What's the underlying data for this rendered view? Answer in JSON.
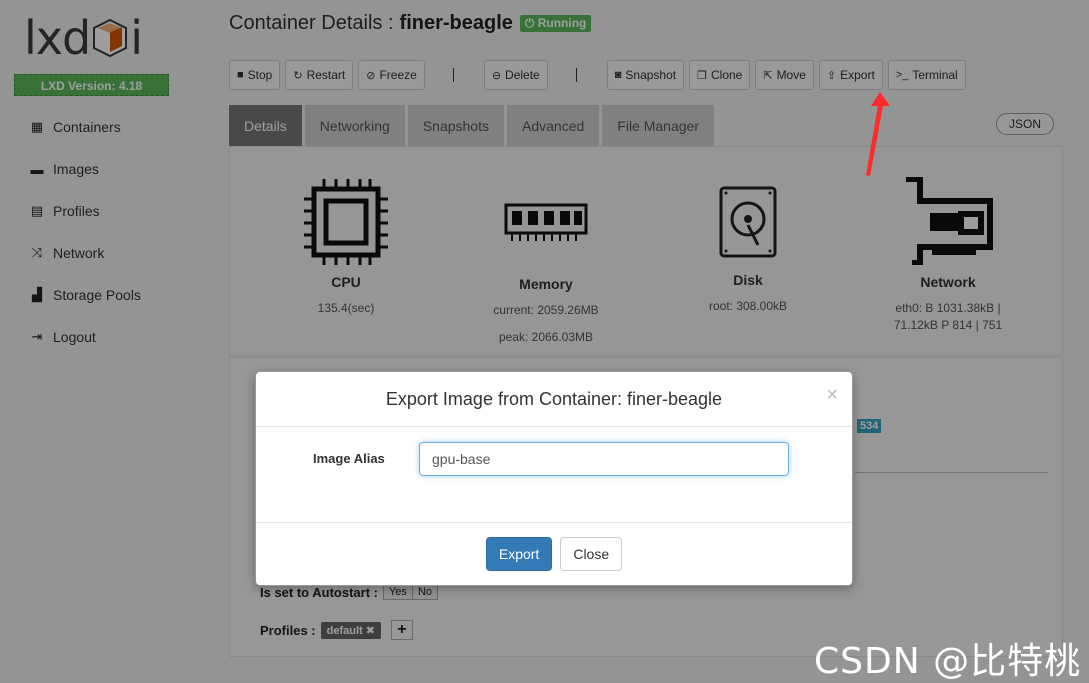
{
  "sidebar": {
    "logo_left": "lxd",
    "logo_right": "i",
    "version": "LXD Version: 4.18",
    "items": [
      {
        "label": "Containers",
        "icon": "grid-icon"
      },
      {
        "label": "Images",
        "icon": "hdd-icon"
      },
      {
        "label": "Profiles",
        "icon": "file-icon"
      },
      {
        "label": "Network",
        "icon": "shuffle-icon"
      },
      {
        "label": "Storage Pools",
        "icon": "tasks-icon"
      },
      {
        "label": "Logout",
        "icon": "logout-icon"
      }
    ]
  },
  "header": {
    "title_prefix": "Container Details :",
    "container_name": "finer-beagle",
    "status": "Running"
  },
  "toolbar": {
    "stop": "Stop",
    "restart": "Restart",
    "freeze": "Freeze",
    "delete": "Delete",
    "snapshot": "Snapshot",
    "clone": "Clone",
    "move": "Move",
    "export": "Export",
    "terminal": "Terminal"
  },
  "tabs": [
    "Details",
    "Networking",
    "Snapshots",
    "Advanced",
    "File Manager"
  ],
  "json_button": "JSON",
  "stats": {
    "cpu": {
      "label": "CPU",
      "value": "135.4(sec)"
    },
    "memory": {
      "label": "Memory",
      "current": "current: 2059.26MB",
      "peak": "peak: 2066.03MB"
    },
    "disk": {
      "label": "Disk",
      "value": "root: 308.00kB"
    },
    "network": {
      "label": "Network",
      "line1": "eth0: B 1031.38kB |",
      "line2": "71.12kB P 814 | 751"
    }
  },
  "details": {
    "badge_value": "534",
    "autostart_label": "Is set to Autostart :",
    "autostart_yes": "Yes",
    "autostart_no": "No",
    "profiles_label": "Profiles :",
    "profile_tag": "default"
  },
  "modal": {
    "title": "Export Image from Container: finer-beagle",
    "close": "×",
    "field_label": "Image Alias",
    "field_value": "gpu-base",
    "export_button": "Export",
    "close_button": "Close"
  },
  "watermark": "CSDN @比特桃",
  "colors": {
    "accent": "#5cb85c",
    "primary": "#337ab7",
    "arrow": "#ff2a2a"
  }
}
